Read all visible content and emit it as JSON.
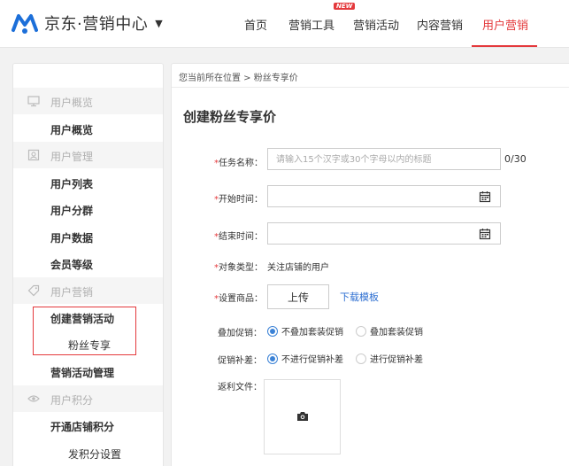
{
  "header": {
    "logo_text": "京东·营销中心",
    "caret": "▼",
    "nav": [
      {
        "label": "首页"
      },
      {
        "label": "营销工具",
        "badge": "NEW"
      },
      {
        "label": "营销活动"
      },
      {
        "label": "内容营销"
      },
      {
        "label": "用户营销",
        "active": true
      }
    ]
  },
  "sidebar": {
    "groups": [
      {
        "label": "用户概览",
        "icon": "monitor-icon",
        "items": [
          "用户概览"
        ]
      },
      {
        "label": "用户管理",
        "icon": "user-card-icon",
        "items": [
          "用户列表",
          "用户分群",
          "用户数据",
          "会员等级"
        ]
      },
      {
        "label": "用户营销",
        "icon": "tag-icon",
        "items": [
          "创建营销活动"
        ],
        "subitems": [
          "粉丝专享"
        ],
        "items_after": [
          "营销活动管理"
        ]
      },
      {
        "label": "用户积分",
        "icon": "eye-icon",
        "items": [
          "开通店铺积分"
        ],
        "subitems": [
          "发积分设置"
        ]
      }
    ]
  },
  "main": {
    "breadcrumb": "您当前所在位置 > 粉丝专享价",
    "title": "创建粉丝专享价",
    "form": {
      "task_name": {
        "label": "任务名称：",
        "placeholder": "请输入15个汉字或30个字母以内的标题",
        "value": "",
        "counter": "0/30",
        "required": "*"
      },
      "start_time": {
        "label": "开始时间：",
        "value": "",
        "required": "*"
      },
      "end_time": {
        "label": "结束时间：",
        "value": "",
        "required": "*"
      },
      "target_type": {
        "label": "对象类型：",
        "value": "关注店铺的用户",
        "required": "*"
      },
      "products": {
        "label": "设置商品：",
        "upload": "上传",
        "template_link": "下载模板",
        "required": "*"
      },
      "stack_promo": {
        "label": "叠加促销：",
        "options": [
          "不叠加套装促销",
          "叠加套装促销"
        ],
        "selected": "不叠加套装促销"
      },
      "promo_diff": {
        "label": "促销补差：",
        "options": [
          "不进行促销补差",
          "进行促销补差"
        ],
        "selected": "不进行促销补差"
      },
      "rebate_file": {
        "label": "返利文件："
      }
    }
  },
  "colors": {
    "accent": "#e4393c",
    "link": "#2e6fd1",
    "radio": "#3b82d6"
  }
}
